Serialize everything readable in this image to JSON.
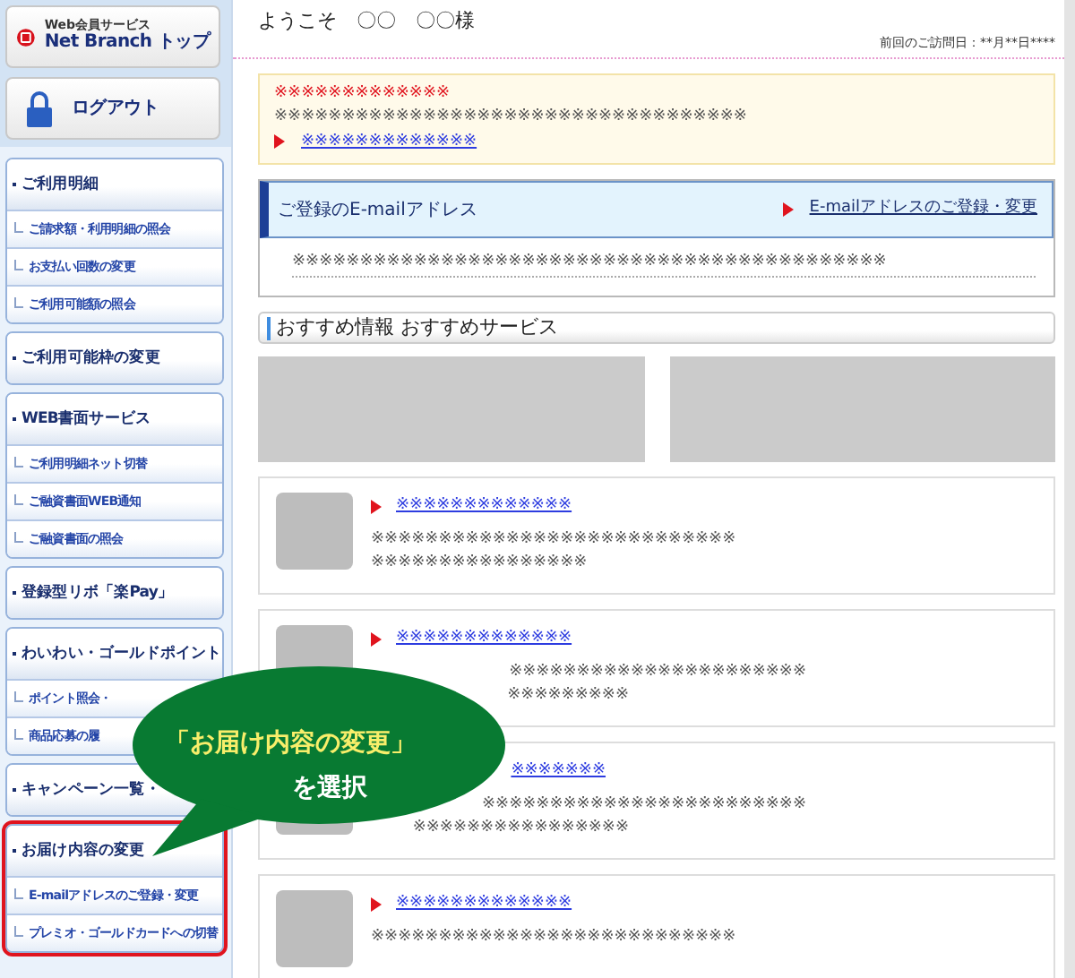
{
  "header_buttons": [
    {
      "kind": "top",
      "subtitle": "Web会員サービス",
      "label": "Net Branch トップ"
    },
    {
      "kind": "logout",
      "label": "ログアウト"
    }
  ],
  "sidebar": {
    "groups": [
      {
        "label": "ご利用明細",
        "highlighted": false,
        "items": [
          "ご請求額・利用明細の照会",
          "お支払い回数の変更",
          "ご利用可能額の照会"
        ]
      },
      {
        "label": "ご利用可能枠の変更",
        "highlighted": false
      },
      {
        "label": "WEB書面サービス",
        "highlighted": false,
        "items": [
          "ご利用明細ネット切替",
          "ご融資書面WEB通知",
          "ご融資書面の照会"
        ]
      },
      {
        "label": "登録型リボ「楽Pay」",
        "highlighted": false
      },
      {
        "label": "わいわい・ゴールドポイント",
        "highlighted": false,
        "items": [
          "ポイント照会・",
          "商品応募の履"
        ]
      },
      {
        "label": "キャンペーン一覧・",
        "highlighted": false
      },
      {
        "label": "お届け内容の変更",
        "highlighted": true,
        "items": [
          "E-mailアドレスのご登録・変更",
          "プレミオ・ゴールドカードへの切替"
        ]
      }
    ]
  },
  "welcome": "ようこそ　〇〇　〇〇様",
  "last_visit": "前回のご訪問日：**月**日****",
  "notice": {
    "title": "※※※※※※※※※※※※※",
    "text": "※※※※※※※※※※※※※※※※※※※※※※※※※※※※※※※※※※※",
    "link": "※※※※※※※※※※※※※"
  },
  "email_panel": {
    "title": "ご登録のE-mailアドレス",
    "link": "E-mailアドレスのご登録・変更",
    "value": "※※※※※※※※※※※※※※※※※※※※※※※※※※※※※※※※※※※※※※※※※※※※"
  },
  "recommend": {
    "title": "おすすめ情報 おすすめサービス"
  },
  "cards": [
    {
      "covered": false,
      "link_covered": false,
      "link": "※※※※※※※※※※※※※",
      "lines": [
        "※※※※※※※※※※※※※※※※※※※※※※※※※※※",
        "※※※※※※※※※※※※※※※※"
      ]
    },
    {
      "covered": true,
      "link_covered": false,
      "link": "※※※※※※※※※※※※※",
      "lines": [
        "※※※※※※※※※※※※※※※※※※※※※※",
        "※※※※※※※※※"
      ]
    },
    {
      "covered": true,
      "link_covered": true,
      "link": "※※※※※※※",
      "lines": [
        "※※※※※※※※※※※※※※※※※※※※※※※※",
        "※※※※※※※※※※※※※※※※"
      ]
    },
    {
      "covered": false,
      "link_covered": false,
      "link": "※※※※※※※※※※※※※",
      "lines": [
        "※※※※※※※※※※※※※※※※※※※※※※※※※※※"
      ]
    }
  ],
  "callout": {
    "title": "「お届け内容の変更」",
    "text": "を選択"
  }
}
